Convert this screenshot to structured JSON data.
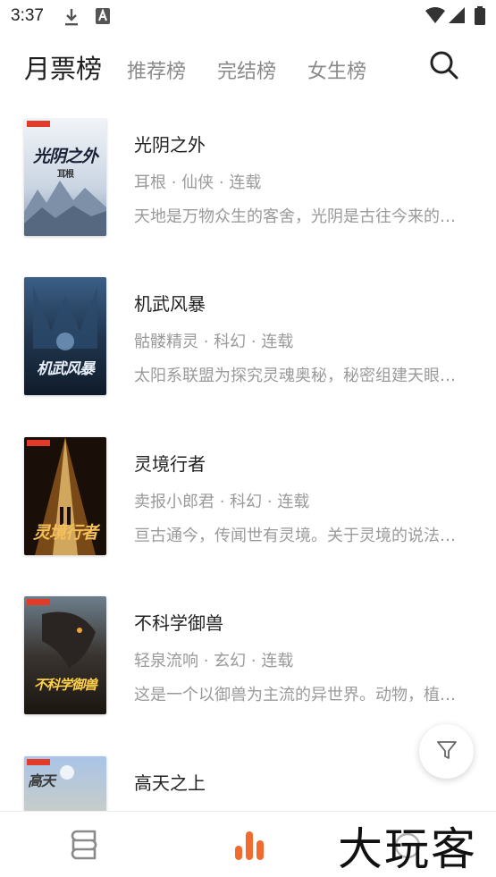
{
  "status_bar": {
    "time": "3:37",
    "icons": [
      "download-icon",
      "a-notification-icon",
      "wifi-icon",
      "signal-icon",
      "battery-icon"
    ]
  },
  "tabs": [
    {
      "label": "月票榜",
      "active": true
    },
    {
      "label": "推荐榜",
      "active": false
    },
    {
      "label": "完结榜",
      "active": false
    },
    {
      "label": "女生榜",
      "active": false
    }
  ],
  "books": [
    {
      "title": "光阴之外",
      "author": "耳根",
      "genre": "仙侠",
      "status": "连载",
      "meta": "耳根 · 仙侠 · 连载",
      "description": "天地是万物众生的客舍，光阴是古往今来的过客。",
      "cover_title": "光阴之外",
      "cover_author": "耳根"
    },
    {
      "title": "机武风暴",
      "author": "骷髅精灵",
      "genre": "科幻",
      "status": "连载",
      "meta": "骷髅精灵 · 科幻 · 连载",
      "description": "太阳系联盟为探究灵魂奥秘，秘密组建天眼计划。",
      "cover_title": "机武风暴",
      "cover_author": ""
    },
    {
      "title": "灵境行者",
      "author": "卖报小郎君",
      "genre": "科幻",
      "status": "连载",
      "meta": "卖报小郎君 · 科幻 · 连载",
      "description": "亘古通今，传闻世有灵境。关于灵境的说法众多。",
      "cover_title": "灵境行者",
      "cover_author": ""
    },
    {
      "title": "不科学御兽",
      "author": "轻泉流响",
      "genre": "玄幻",
      "status": "连载",
      "meta": "轻泉流响 · 玄幻 · 连载",
      "description": "这是一个以御兽为主流的异世界。动物，植物都能契约。",
      "cover_title": "不科学御兽",
      "cover_author": ""
    },
    {
      "title": "高天之上",
      "author": "",
      "genre": "",
      "status": "",
      "meta": "",
      "description": "",
      "cover_title": "高天",
      "cover_author": ""
    }
  ],
  "bottom_nav": [
    {
      "name": "bookshelf",
      "icon": "bookshelf-icon",
      "active": false
    },
    {
      "name": "ranking",
      "icon": "bar-chart-icon",
      "active": true
    },
    {
      "name": "discover",
      "icon": "discover-icon",
      "active": false
    }
  ],
  "watermark": "大玩客",
  "colors": {
    "accent": "#f26a2e",
    "text_primary": "#222222",
    "text_secondary": "#9a9a9a",
    "tab_inactive": "#8a8a8a"
  }
}
